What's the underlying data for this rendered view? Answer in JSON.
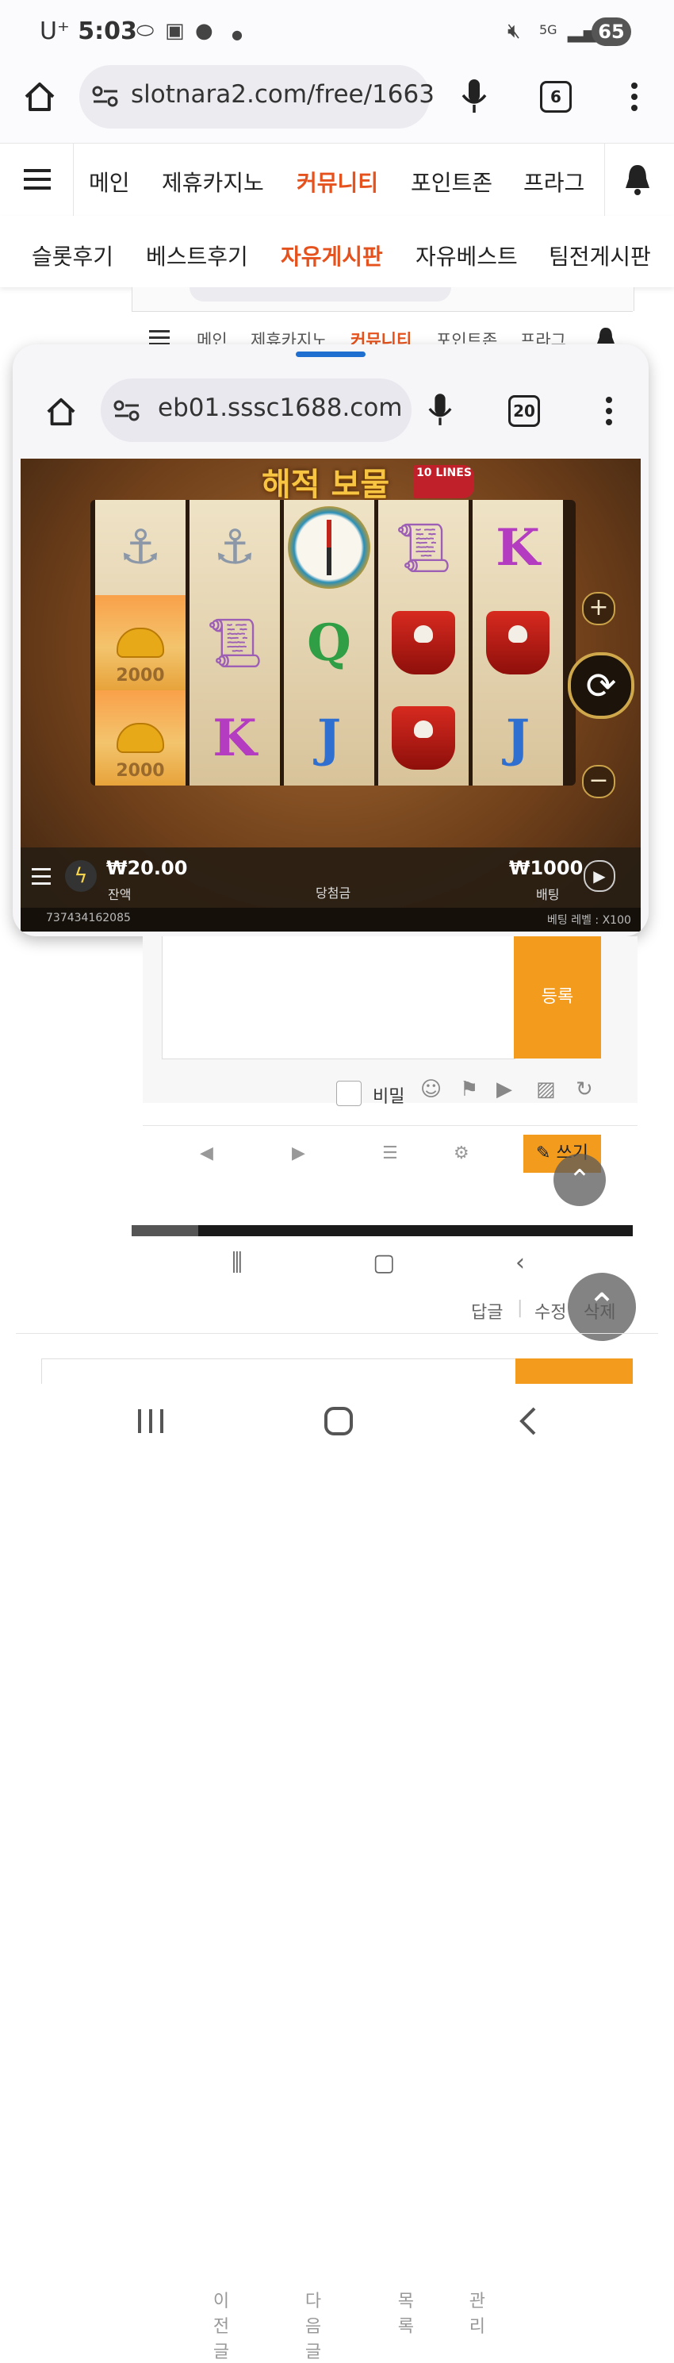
{
  "status_bar": {
    "carrier": "U⁺",
    "time": "5:03",
    "network": "5G",
    "battery": "65"
  },
  "browser": {
    "url": "slotnara2.com/free/1663",
    "tab_count": "6"
  },
  "site_nav": {
    "items": [
      "메인",
      "제휴카지노",
      "커뮤니티",
      "포인트존",
      "프라그"
    ],
    "active": "커뮤니티"
  },
  "sub_nav": {
    "items": [
      "슬롯후기",
      "베스트후기",
      "자유게시판",
      "자유베스트",
      "팀전게시판"
    ],
    "active": "자유게시판"
  },
  "background_nav": {
    "items": [
      "메인",
      "제휴카지노",
      "커뮤니티",
      "포인트존",
      "프라그"
    ]
  },
  "popup": {
    "url": "eb01.sssc1688.com",
    "tab_count": "20",
    "game": {
      "title": "해적 보물",
      "lines_badge": "10 LINES",
      "balance_value": "₩20.00",
      "balance_label": "잔액",
      "win_label": "당첨금",
      "bet_value": "₩1000",
      "bet_label": "배팅",
      "round_id": "737434162085",
      "bet_level": "베팅 레벨 : X100",
      "gold_amount": "2000",
      "letters": [
        "K",
        "Q",
        "J",
        "K",
        "J",
        "K"
      ]
    }
  },
  "comment_form": {
    "submit_label": "등록",
    "secret_label": "비밀"
  },
  "post_actions": {
    "prev": "이전글",
    "next": "다음글",
    "list": "목록",
    "manage": "관리",
    "write": "쓰기"
  },
  "comment_actions": {
    "reply": "답글",
    "edit": "수정",
    "delete": "삭제"
  },
  "colors": {
    "accent": "#e5521d",
    "button": "#f39b1d"
  }
}
